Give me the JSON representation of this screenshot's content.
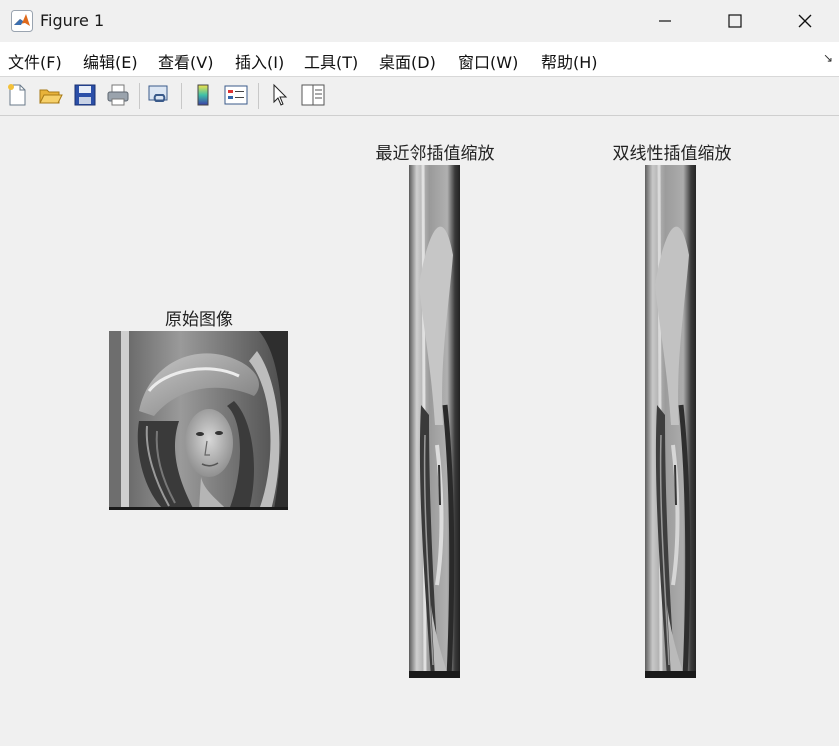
{
  "window": {
    "title": "Figure 1"
  },
  "menu": [
    {
      "label": "文件(F)"
    },
    {
      "label": "编辑(E)"
    },
    {
      "label": "查看(V)"
    },
    {
      "label": "插入(I)"
    },
    {
      "label": "工具(T)"
    },
    {
      "label": "桌面(D)"
    },
    {
      "label": "窗口(W)"
    },
    {
      "label": "帮助(H)"
    }
  ],
  "toolbar": [
    {
      "icon": "new-figure-icon"
    },
    {
      "icon": "open-file-icon"
    },
    {
      "icon": "save-icon"
    },
    {
      "icon": "print-icon"
    },
    {
      "icon": "link-plot-icon"
    },
    {
      "icon": "insert-colorbar-icon"
    },
    {
      "icon": "insert-legend-icon"
    },
    {
      "icon": "edit-plot-pointer-icon"
    },
    {
      "icon": "property-inspector-icon"
    }
  ],
  "axes": [
    {
      "title": "原始图像"
    },
    {
      "title": "最近邻插值缩放"
    },
    {
      "title": "双线性插值缩放"
    }
  ]
}
